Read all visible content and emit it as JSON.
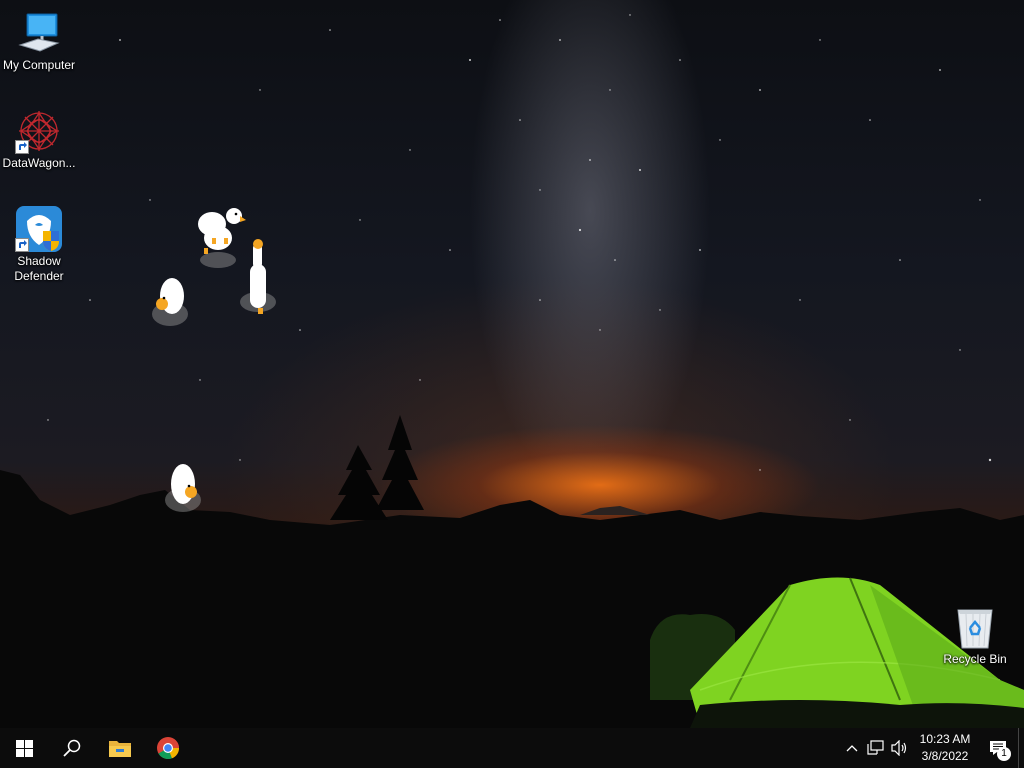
{
  "desktop": {
    "icons": [
      {
        "label": "My Computer",
        "icon": "computer-icon"
      },
      {
        "label": "DataWagon...",
        "icon": "datawagon-icon"
      },
      {
        "label": "Shadow Defender",
        "icon": "shadow-defender-icon"
      },
      {
        "label": "Recycle Bin",
        "icon": "recycle-bin-icon"
      }
    ]
  },
  "taskbar": {
    "buttons": [
      {
        "name": "Start",
        "icon": "windows-icon"
      },
      {
        "name": "Search",
        "icon": "search-icon"
      },
      {
        "name": "File Explorer",
        "icon": "folder-icon"
      },
      {
        "name": "Google Chrome",
        "icon": "chrome-icon"
      }
    ],
    "tray": {
      "time": "10:23 AM",
      "date": "3/8/2022",
      "notification_count": "1"
    }
  },
  "colors": {
    "taskbar_bg": "#0c0c0c",
    "tent": "#7fd321",
    "horizon_glow": "#ff7a14"
  }
}
